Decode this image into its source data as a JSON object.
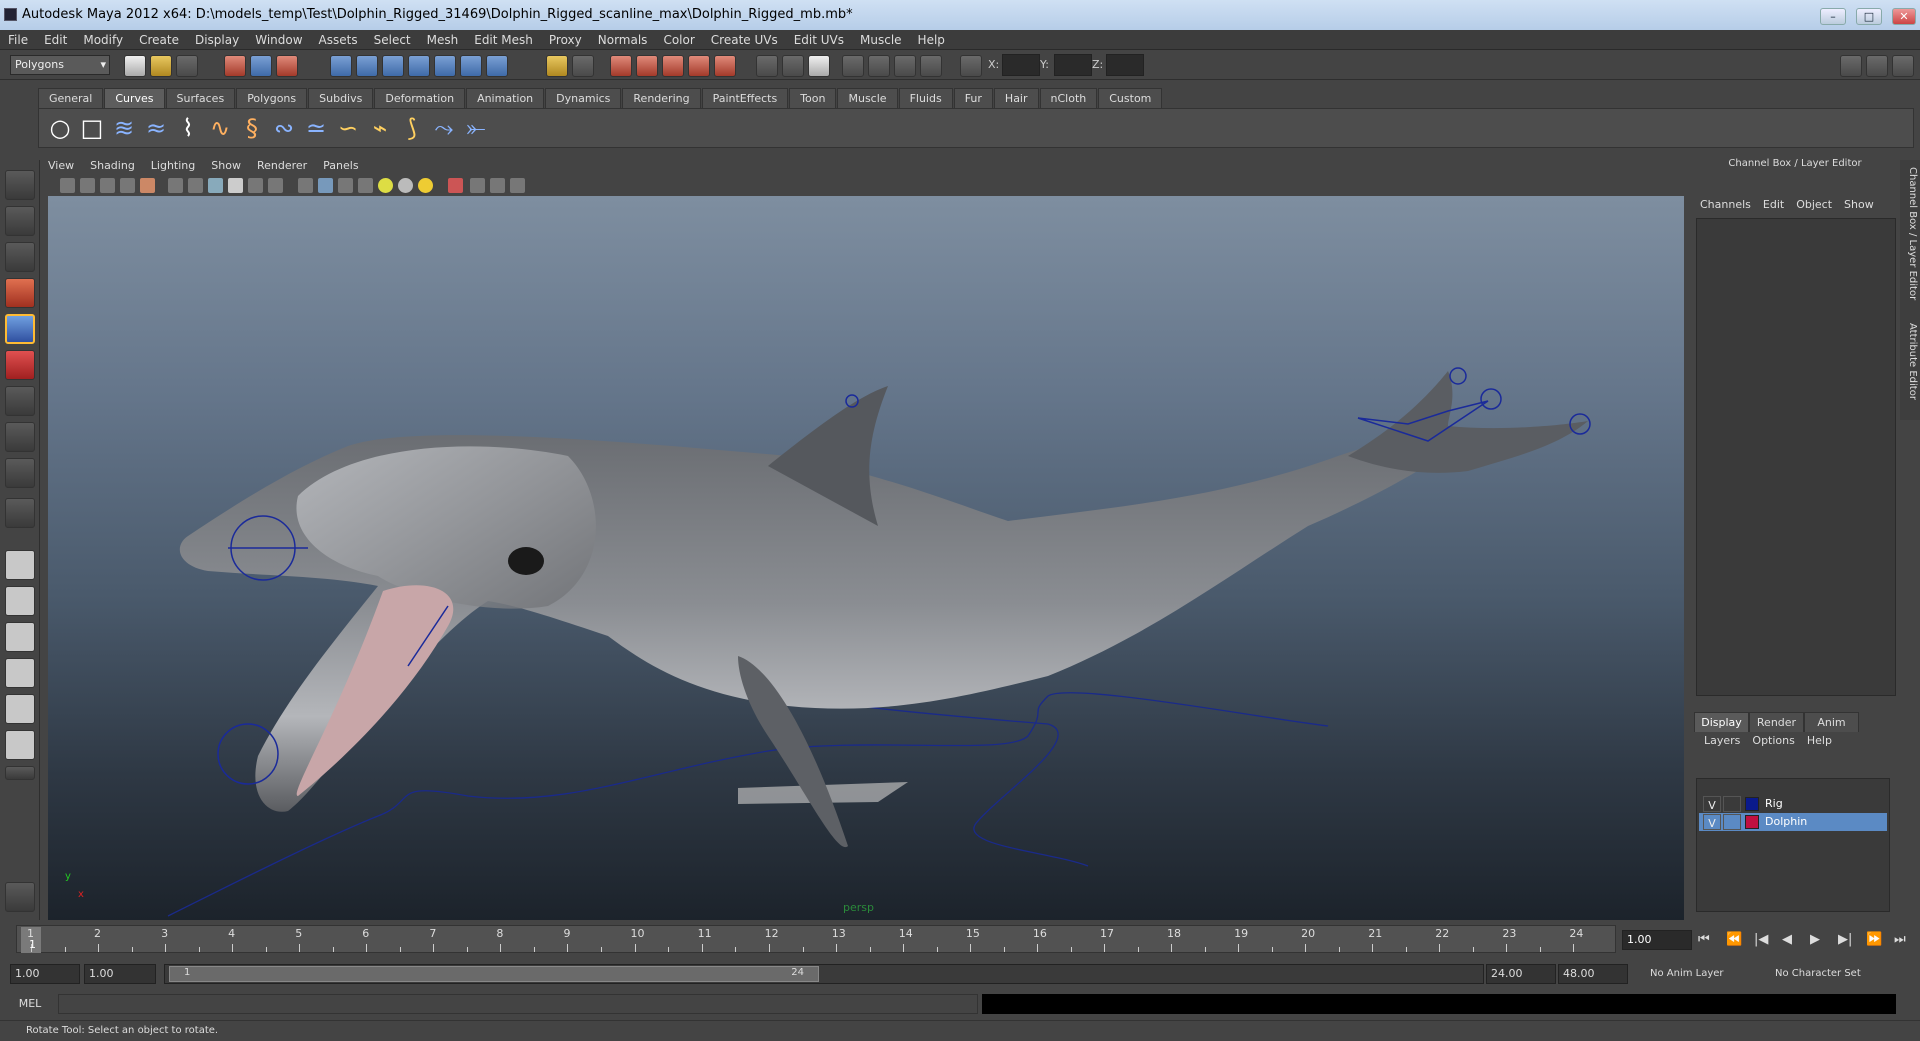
{
  "window": {
    "title": "Autodesk Maya 2012 x64: D:\\models_temp\\Test\\Dolphin_Rigged_31469\\Dolphin_Rigged_scanline_max\\Dolphin_Rigged_mb.mb*",
    "min": "–",
    "max": "□",
    "close": "✕"
  },
  "menu": [
    "File",
    "Edit",
    "Modify",
    "Create",
    "Display",
    "Window",
    "Assets",
    "Select",
    "Mesh",
    "Edit Mesh",
    "Proxy",
    "Normals",
    "Color",
    "Create UVs",
    "Edit UVs",
    "Muscle",
    "Help"
  ],
  "status": {
    "mode": "Polygons",
    "x_label": "X:",
    "y_label": "Y:",
    "z_label": "Z:"
  },
  "shelf": {
    "tabs": [
      "General",
      "Curves",
      "Surfaces",
      "Polygons",
      "Subdivs",
      "Deformation",
      "Animation",
      "Dynamics",
      "Rendering",
      "PaintEffects",
      "Toon",
      "Muscle",
      "Fluids",
      "Fur",
      "Hair",
      "nCloth",
      "Custom"
    ],
    "active": "Curves"
  },
  "panel": {
    "menu": [
      "View",
      "Shading",
      "Lighting",
      "Show",
      "Renderer",
      "Panels"
    ],
    "camera": "persp",
    "axis_y": "y",
    "axis_x": "x"
  },
  "channelbox": {
    "title": "Channel Box / Layer Editor",
    "menu": [
      "Channels",
      "Edit",
      "Object",
      "Show"
    ]
  },
  "layers": {
    "tabs": [
      "Display",
      "Render",
      "Anim"
    ],
    "active": "Display",
    "menu": [
      "Layers",
      "Options",
      "Help"
    ],
    "rows": [
      {
        "v": "V",
        "name": "Rig",
        "color": "#0a1a8c",
        "selected": false
      },
      {
        "v": "V",
        "name": "Dolphin",
        "color": "#c01040",
        "selected": true
      }
    ]
  },
  "sidetabs": [
    "Channel Box / Layer Editor",
    "Attribute Editor"
  ],
  "timeline": {
    "ticks": [
      "1",
      "2",
      "3",
      "4",
      "5",
      "6",
      "7",
      "8",
      "9",
      "10",
      "11",
      "12",
      "13",
      "14",
      "15",
      "16",
      "17",
      "18",
      "19",
      "20",
      "21",
      "22",
      "23",
      "24"
    ],
    "current": "1",
    "current_field": "1.00"
  },
  "range": {
    "start": "1.00",
    "start_inner": "1.00",
    "thumb_start": "1",
    "thumb_end": "24",
    "end_inner": "24.00",
    "end": "48.00",
    "anim_layer": "No Anim Layer",
    "char_set": "No Character Set"
  },
  "command": {
    "label": "MEL"
  },
  "help": "Rotate Tool: Select an object to rotate.",
  "colors": {
    "accent": "#5b8ac4",
    "viewport_top": "#7e8ea0",
    "viewport_bottom": "#1c232b"
  }
}
